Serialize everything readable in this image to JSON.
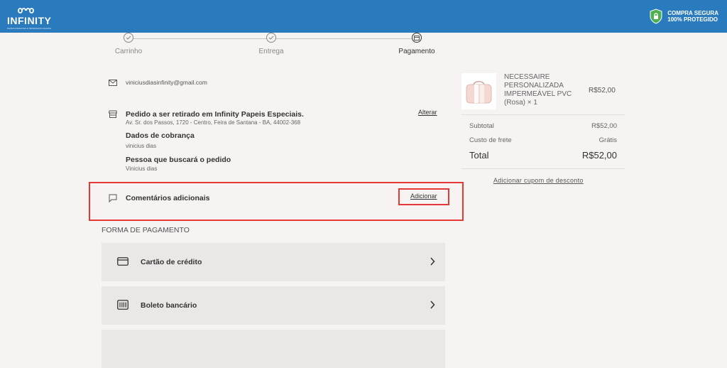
{
  "header": {
    "logo_text": "INFINITY",
    "logo_subtext": "PAPEIS ESPECIAIS E IMPRESSOS DIGITAIS",
    "secure_line1": "COMPRA SEGURA",
    "secure_line2": "100% PROTEGIDO"
  },
  "steps": [
    {
      "label": "Carrinho"
    },
    {
      "label": "Entrega"
    },
    {
      "label": "Pagamento"
    }
  ],
  "contact": {
    "email": "viniciusdiasinfinity@gmail.com"
  },
  "pickup": {
    "title": "Pedido a ser retirado em Infinity Papeis Especiais.",
    "address": "Av. Sr. dos Passos, 1720 - Centro, Feira de Santana - BA, 44002-368",
    "change_label": "Alterar",
    "billing_title": "Dados de cobrança",
    "billing_name": "vinicius dias",
    "pickup_person_title": "Pessoa que buscará o pedido",
    "pickup_person_name": "Vinicius dias"
  },
  "comments": {
    "label": "Comentários adicionais",
    "add_label": "Adicionar"
  },
  "payment": {
    "section_title": "FORMA DE PAGAMENTO",
    "options": [
      {
        "label": "Cartão de crédito",
        "icon": "credit-card-icon"
      },
      {
        "label": "Boleto bancário",
        "icon": "barcode-icon"
      }
    ]
  },
  "summary": {
    "product_name": "NECESSAIRE PERSONALIZADA IMPERMEÁVEL PVC (Rosa) × 1",
    "product_price": "R$52,00",
    "subtotal_label": "Subtotal",
    "subtotal_value": "R$52,00",
    "shipping_label": "Custo de frete",
    "shipping_value": "Grátis",
    "total_label": "Total",
    "total_value": "R$52,00",
    "coupon_label": "Adicionar cupom de desconto"
  },
  "colors": {
    "header_bg": "#2a7bbd",
    "highlight": "#e53935",
    "shield": "#4caf50"
  }
}
